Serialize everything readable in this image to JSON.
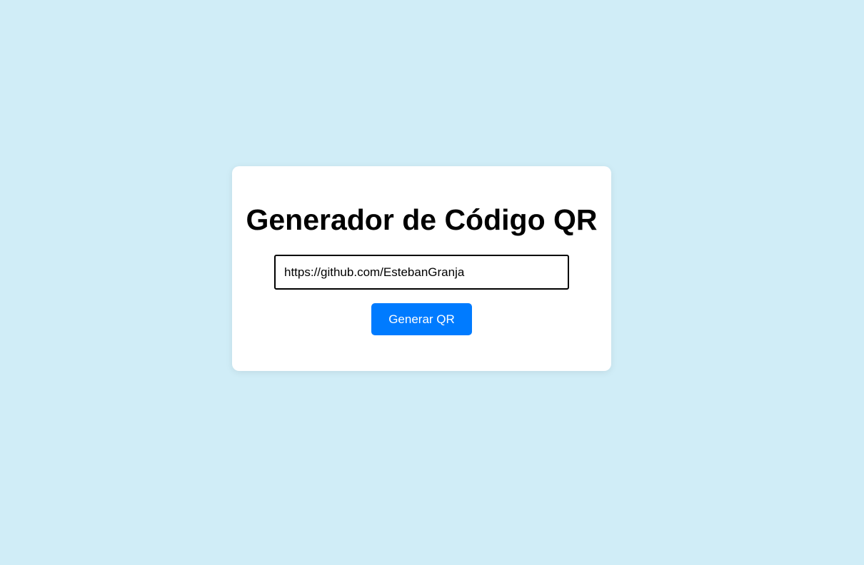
{
  "card": {
    "title": "Generador de Código QR",
    "input": {
      "value": "https://github.com/EstebanGranja",
      "placeholder": ""
    },
    "button_label": "Generar QR"
  },
  "colors": {
    "background": "#d0edf7",
    "card": "#ffffff",
    "button": "#007bff",
    "button_text": "#ffffff",
    "text": "#000000"
  }
}
